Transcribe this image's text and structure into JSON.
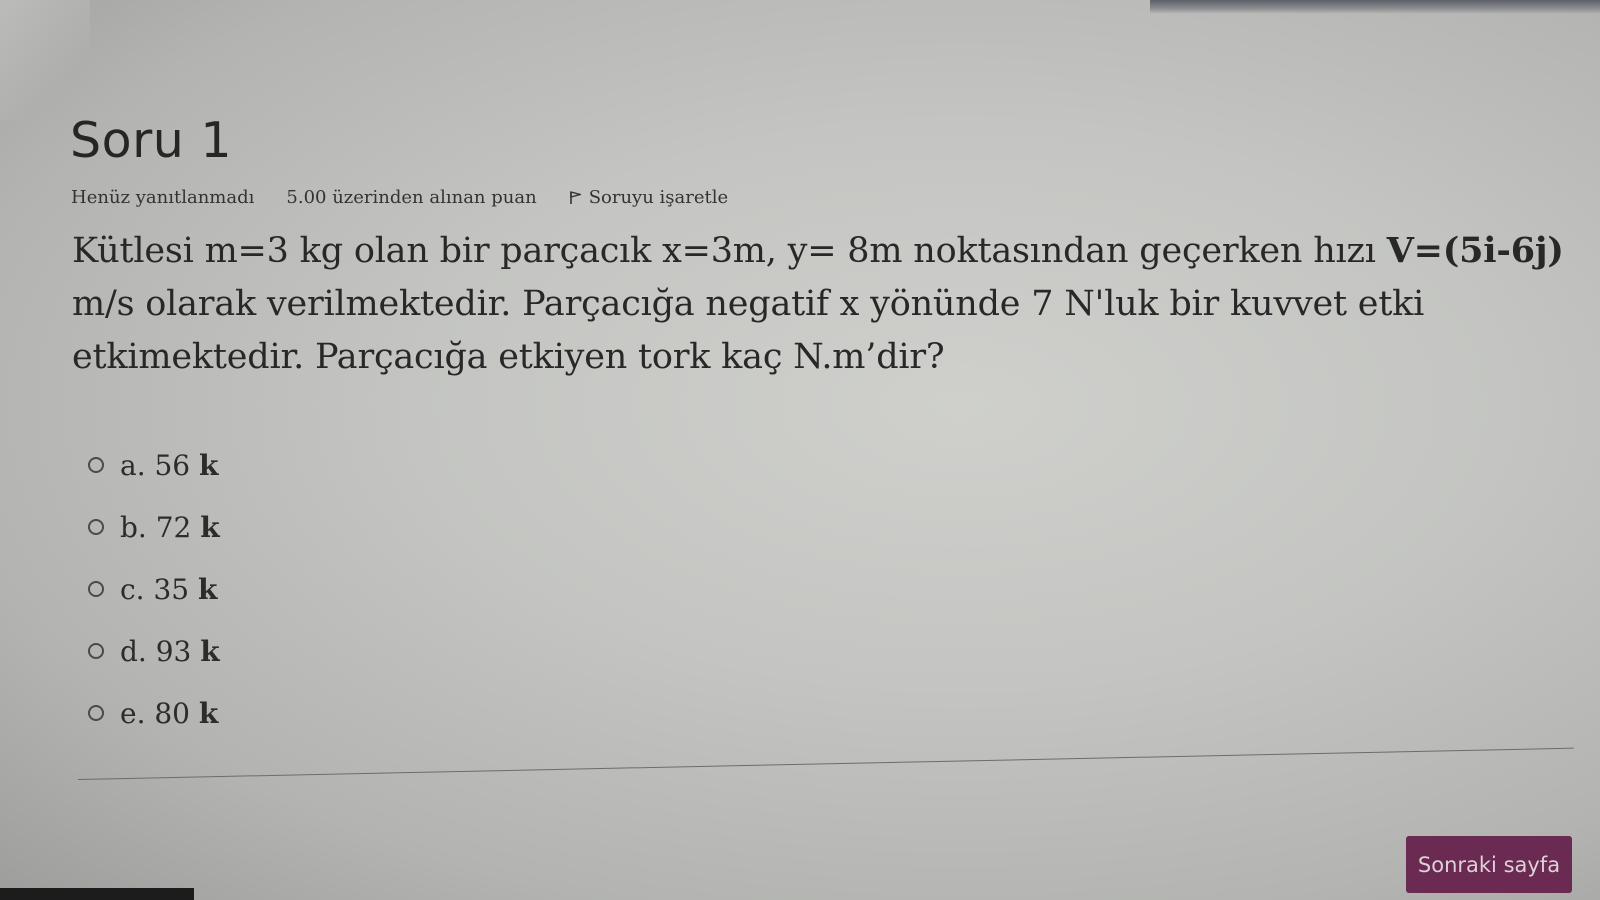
{
  "question": {
    "title": "Soru 1",
    "status": "Henüz yanıtlanmadı",
    "points": "5.00 üzerinden alınan puan",
    "flag_label": "Soruyu işaretle",
    "text_part1": "Kütlesi m=3 kg olan bir parçacık x=3m, y= 8m noktasından geçerken hızı ",
    "text_bold": "V=(5i-6j)",
    "text_part2": "  m/s olarak verilmektedir. Parçacığa negatif x yönünde 7 N'luk bir kuvvet etki etkimektedir. Parçacığa etkiyen tork kaç N.m’dir?"
  },
  "answers": [
    {
      "prefix": "a. 56 ",
      "unit": "k"
    },
    {
      "prefix": "b. 72 ",
      "unit": "k"
    },
    {
      "prefix": "c. 35 ",
      "unit": "k"
    },
    {
      "prefix": "d. 93 ",
      "unit": "k"
    },
    {
      "prefix": "e. 80 ",
      "unit": "k"
    }
  ],
  "navigation": {
    "next_label": "Sonraki sayfa"
  },
  "colors": {
    "next_button": "#6a2a52"
  },
  "icons": {
    "flag": "flag-icon",
    "radio": "radio-unselected"
  }
}
